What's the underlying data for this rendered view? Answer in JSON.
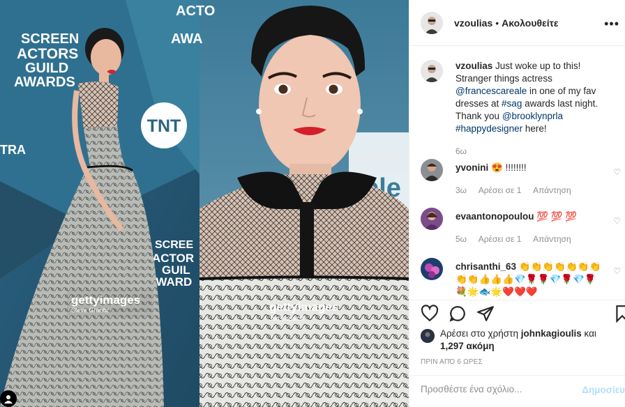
{
  "photo": {
    "left_text": [
      "SCREEN",
      "ACTORS",
      "GUILD",
      "AWARDS"
    ],
    "tnt_label": "TNT",
    "tra_text": "TRA",
    "small_text": [
      "SCREE",
      "ACTOR",
      "GUIL",
      "AWARD"
    ],
    "right_top_text": [
      "ACTO",
      "AWA"
    ],
    "right_bottom_text": "ble",
    "credit_left_brand": "gettyimages",
    "credit_left_name": "Steve Granitz",
    "credit_right_brand": "gettyimages",
    "credit_right_name": "Jon Kopaloff",
    "colors": {
      "backdrop": "#2f5f7c",
      "lips": "#d3202a"
    }
  },
  "header": {
    "username": "vzoulias",
    "separator": "•",
    "follow_label": "Ακολουθείτε",
    "more_icon": "more-horizontal-icon"
  },
  "caption": {
    "username": "vzoulias",
    "text_1": "Just woke up to this! Stranger things actress",
    "mention_1": "@francescareale",
    "text_2": "in one of my fav dresses at",
    "hashtag_1": "#sag",
    "text_3": "awards last night. Thank you",
    "mention_2": "@brooklynprla",
    "hashtag_2": "#happydesigner",
    "text_4": "here!",
    "time": "6ω"
  },
  "comments": [
    {
      "username": "yvonini",
      "text": "😍 !!!!!!!!",
      "time": "3ω",
      "likes": "Αρέσει σε 1",
      "reply": "Απάντηση"
    },
    {
      "username": "evaantonopoulou",
      "text": "💯 💯 💯",
      "time": "5ω",
      "likes": "Αρέσει σε 1",
      "reply": "Απάντηση"
    },
    {
      "username": "chrisanthi_63",
      "text": "👏👏👏👏👏👏👏👏👏👍👍👍💎🌹🌹💎🌹💎🌹💐🌟🐟🌟❤️❤️❤️",
      "time": "",
      "likes": "",
      "reply": ""
    }
  ],
  "actions": {
    "like_icon": "heart-icon",
    "comment_icon": "comment-icon",
    "share_icon": "share-icon",
    "save_icon": "bookmark-icon"
  },
  "likes": {
    "prefix": "Αρέσει στο χρήστη",
    "user": "johnkagioulis",
    "middle": "και",
    "count": "1,297 ακόμη"
  },
  "timestamp": "ΠΡΙΝ ΑΠΌ 6 ΩΡΕΣ",
  "add_comment": {
    "placeholder": "Προσθέστε ένα σχόλιο...",
    "post_label": "Δημοσίευ"
  }
}
